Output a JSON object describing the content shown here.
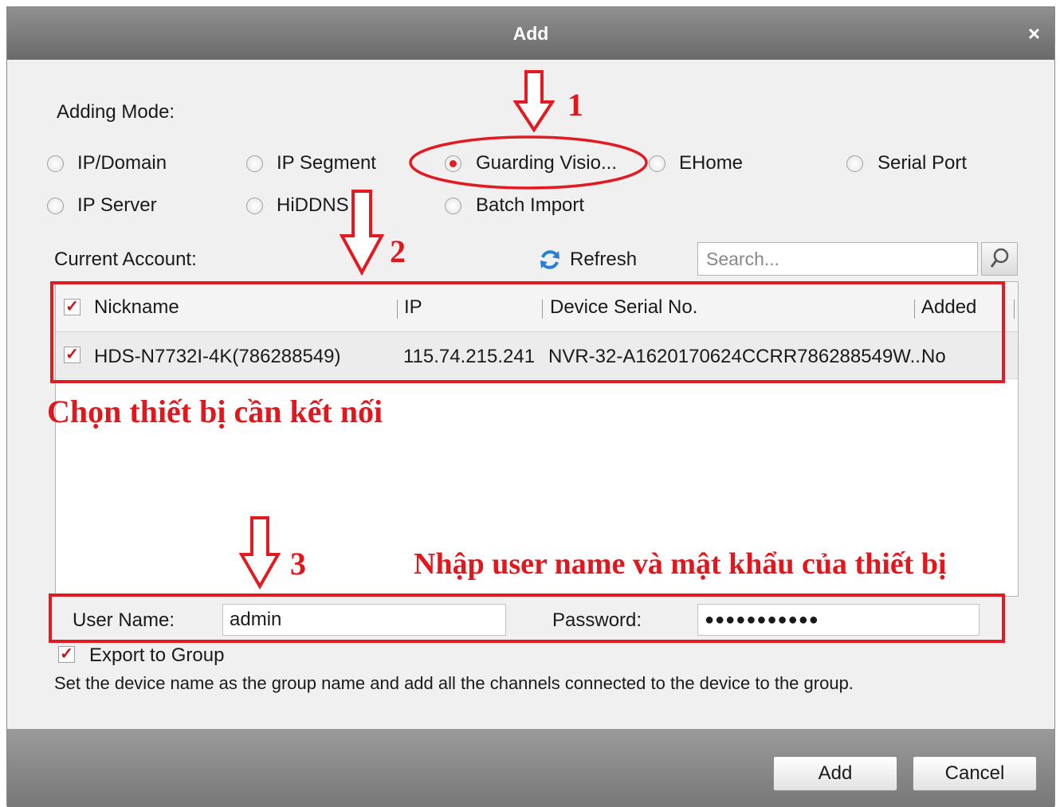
{
  "dialog": {
    "title": "Add",
    "close_label": "×"
  },
  "adding_mode": {
    "label": "Adding Mode:",
    "options": [
      {
        "label": "IP/Domain",
        "selected": false
      },
      {
        "label": "IP Segment",
        "selected": false
      },
      {
        "label": "Guarding Visio...",
        "selected": true
      },
      {
        "label": "EHome",
        "selected": false
      },
      {
        "label": "Serial Port",
        "selected": false
      },
      {
        "label": "IP Server",
        "selected": false
      },
      {
        "label": "HiDDNS",
        "selected": false
      },
      {
        "label": "Batch Import",
        "selected": false
      }
    ]
  },
  "account": {
    "label": "Current Account:",
    "refresh_label": "Refresh",
    "search_placeholder": "Search..."
  },
  "table": {
    "columns": [
      "Nickname",
      "IP",
      "Device Serial No.",
      "Added"
    ],
    "rows": [
      {
        "checked": true,
        "nickname": "HDS-N7732I-4K(786288549)",
        "ip": "115.74.215.241",
        "serial": "NVR-32-A1620170624CCRR786288549W...",
        "added": "No"
      }
    ]
  },
  "credentials": {
    "username_label": "User Name:",
    "username_value": "admin",
    "password_label": "Password:",
    "password_value": "●●●●●●●●●●●"
  },
  "export": {
    "label": "Export to Group",
    "checked": true,
    "description": "Set the device name as the group name and add all the channels connected to the device to the group."
  },
  "buttons": {
    "add": "Add",
    "cancel": "Cancel"
  },
  "annotations": {
    "step1": "1",
    "step2": "2",
    "step3": "3",
    "select_device": "Chọn thiết bị cần kết nối",
    "enter_credentials": "Nhập user name và mật khẩu của thiết bị"
  },
  "colors": {
    "annotation_red": "#e21b22",
    "titlebar": "#7a7a7a",
    "dialog_bg": "#f0f0f0"
  }
}
